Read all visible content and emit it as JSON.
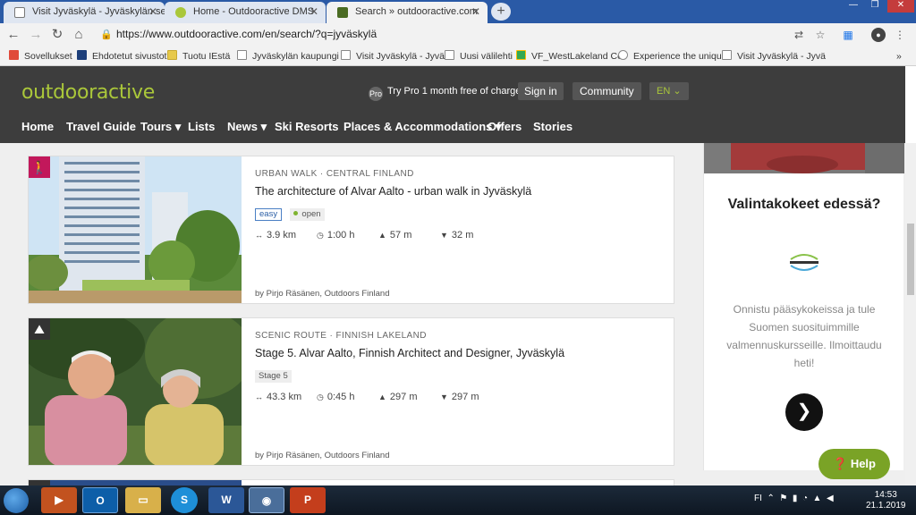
{
  "tabs": [
    {
      "title": "Visit Jyväskylä - Jyväskylän seudu",
      "active": false
    },
    {
      "title": "Home - Outdooractive DMS",
      "active": false
    },
    {
      "title": "Search » outdooractive.com",
      "active": true
    }
  ],
  "address_bar": {
    "url": "https://www.outdooractive.com/en/search/?q=jyväskylä"
  },
  "bookmarks": [
    {
      "label": "Sovellukset"
    },
    {
      "label": "Ehdotetut sivustot"
    },
    {
      "label": "Tuotu IEstä"
    },
    {
      "label": "Jyväskylän kaupungi"
    },
    {
      "label": "Visit Jyväskylä - Jyvä"
    },
    {
      "label": "Uusi välilehti"
    },
    {
      "label": "VF_WestLakeland Co"
    },
    {
      "label": "Experience the uniqu"
    },
    {
      "label": "Visit Jyväskylä - Jyvä"
    }
  ],
  "header": {
    "logo": "outdooractive",
    "promo": "Try Pro 1 month free of charge",
    "sign_in": "Sign in",
    "community": "Community",
    "language": "EN"
  },
  "nav": [
    {
      "label": "Home"
    },
    {
      "label": "Travel Guide"
    },
    {
      "label": "Tours ▾"
    },
    {
      "label": "Lists"
    },
    {
      "label": "News ▾"
    },
    {
      "label": "Ski Resorts"
    },
    {
      "label": "Places & Accommodations ▾"
    },
    {
      "label": "Offers"
    },
    {
      "label": "Stories"
    }
  ],
  "results": [
    {
      "category": "URBAN WALK · CENTRAL FINLAND",
      "title": "The architecture of Alvar Aalto - urban walk in Jyväskylä",
      "difficulty": "easy",
      "status": "open",
      "distance": "3.9 km",
      "duration": "1:00 h",
      "ascent": "57 m",
      "descent": "32 m",
      "author": "by Pirjo Räsänen,  Outdoors Finland",
      "badge_color": "#c2185b"
    },
    {
      "category": "SCENIC ROUTE · FINNISH LAKELAND",
      "title": "Stage 5. Alvar Aalto, Finnish Architect and Designer, Jyväskylä",
      "stage": "Stage 5",
      "distance": "43.3 km",
      "duration": "0:45 h",
      "ascent": "297 m",
      "descent": "297 m",
      "author": "by Pirjo Räsänen,  Outdoors Finland",
      "badge_color": "#333333"
    }
  ],
  "ad": {
    "title": "Valintakokeet edessä?",
    "text": "Onnistu pääsykokeissa ja tule Suomen suosituimmille valmennuskursseille. Ilmoittaudu heti!"
  },
  "help_button": "Help",
  "taskbar": {
    "lang": "FI",
    "time": "14:53",
    "date": "21.1.2019"
  }
}
